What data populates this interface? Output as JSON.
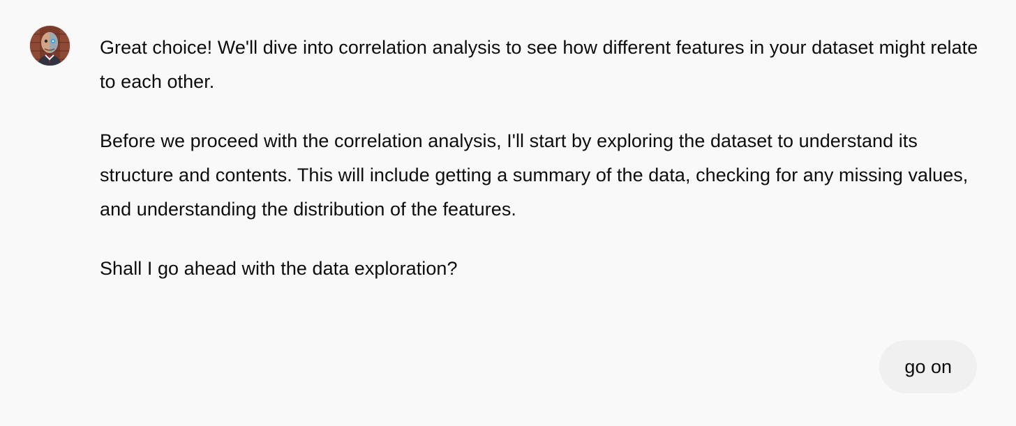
{
  "assistant": {
    "avatar_icon": "robot-human-avatar-icon",
    "paragraphs": [
      "Great choice! We'll dive into correlation analysis to see how different features in your dataset might relate to each other.",
      "Before we proceed with the correlation analysis, I'll start by exploring the dataset to understand its structure and contents. This will include getting a summary of the data, checking for any missing values, and understanding the distribution of the features.",
      "Shall I go ahead with the data exploration?"
    ]
  },
  "user": {
    "message": "go on"
  },
  "colors": {
    "background": "#f9f9f9",
    "user_bubble": "#f0f0f0",
    "text": "#0d0d0d"
  }
}
